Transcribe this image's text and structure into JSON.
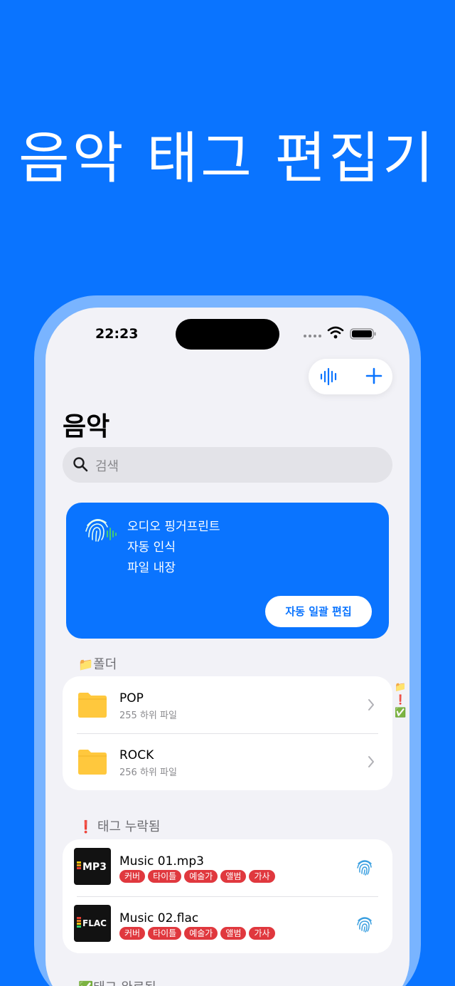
{
  "hero": {
    "title": "음악 태그 편집기"
  },
  "status_bar": {
    "time": "22:23"
  },
  "toolbar": {
    "waveform_icon": "waveform-icon",
    "add_icon": "plus-icon"
  },
  "page": {
    "title": "음악"
  },
  "search": {
    "placeholder": "검색"
  },
  "promo": {
    "lines": [
      "오디오 핑거프린트",
      "자동 인식",
      "파일 내장"
    ],
    "button_label": "자동 일괄 편집"
  },
  "sections": {
    "folders": {
      "emoji": "📁",
      "title": "폴더"
    },
    "missing": {
      "emoji": "❗",
      "title": "태그 누락됨"
    },
    "complete": {
      "emoji": "✅",
      "title": "태그 완료됨"
    }
  },
  "folders": [
    {
      "name": "POP",
      "subtitle": "255 하위 파일"
    },
    {
      "name": "ROCK",
      "subtitle": "256 하위 파일"
    }
  ],
  "missing_files": [
    {
      "name": "Music 01.mp3",
      "art_label": "MP3",
      "tags": [
        "커버",
        "타이틀",
        "예술가",
        "앨범",
        "가사"
      ]
    },
    {
      "name": "Music 02.flac",
      "art_label": "FLAC",
      "tags": [
        "커버",
        "타이틀",
        "예술가",
        "앨범",
        "가사"
      ]
    }
  ],
  "side_index": [
    "📁",
    "❗",
    "✅"
  ],
  "colors": {
    "accent": "#0A74FF",
    "chip": "#E0383E",
    "folder": "#FFC83D"
  }
}
